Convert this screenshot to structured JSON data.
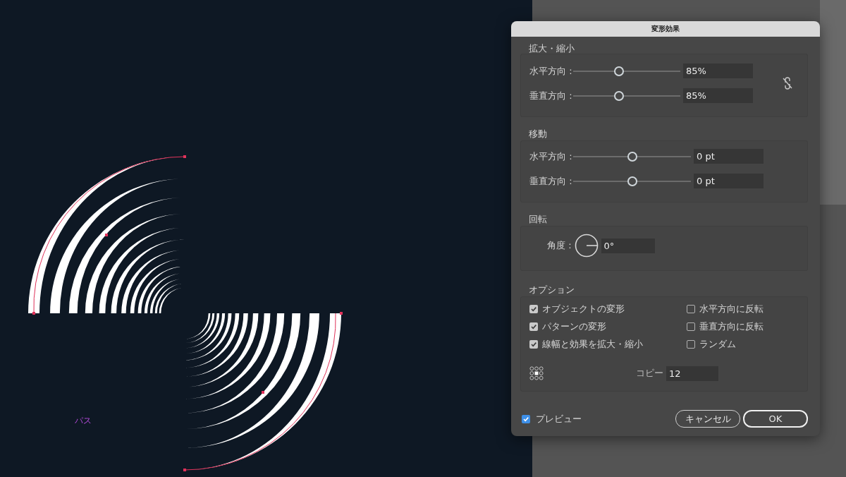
{
  "canvas": {
    "path_label": "パス"
  },
  "dialog": {
    "title": "変形効果",
    "scale": {
      "heading": "拡大・縮小",
      "rows": [
        {
          "label": "水平方向 :",
          "level": 0.43,
          "value": "85%"
        },
        {
          "label": "垂直方向 :",
          "level": 0.43,
          "value": "85%"
        }
      ]
    },
    "move": {
      "heading": "移動",
      "rows": [
        {
          "label": "水平方向 :",
          "level": 0.5,
          "value": "0 pt"
        },
        {
          "label": "垂直方向 :",
          "level": 0.5,
          "value": "0 pt"
        }
      ]
    },
    "rotate": {
      "heading": "回転",
      "label": "角度 :",
      "value": "0°"
    },
    "options": {
      "heading": "オプション",
      "checkboxes": [
        {
          "label": "オブジェクトの変形",
          "checked": true
        },
        {
          "label": "水平方向に反転",
          "checked": false
        },
        {
          "label": "パターンの変形",
          "checked": true
        },
        {
          "label": "垂直方向に反転",
          "checked": false
        },
        {
          "label": "線幅と効果を拡大・縮小",
          "checked": true
        },
        {
          "label": "ランダム",
          "checked": false
        }
      ],
      "copies_label": "コピー",
      "copies_value": "12"
    },
    "preview": {
      "label": "プレビュー",
      "checked": true
    },
    "buttons": [
      {
        "label": "キャンセル",
        "default": false
      },
      {
        "label": "OK",
        "default": true
      }
    ]
  }
}
